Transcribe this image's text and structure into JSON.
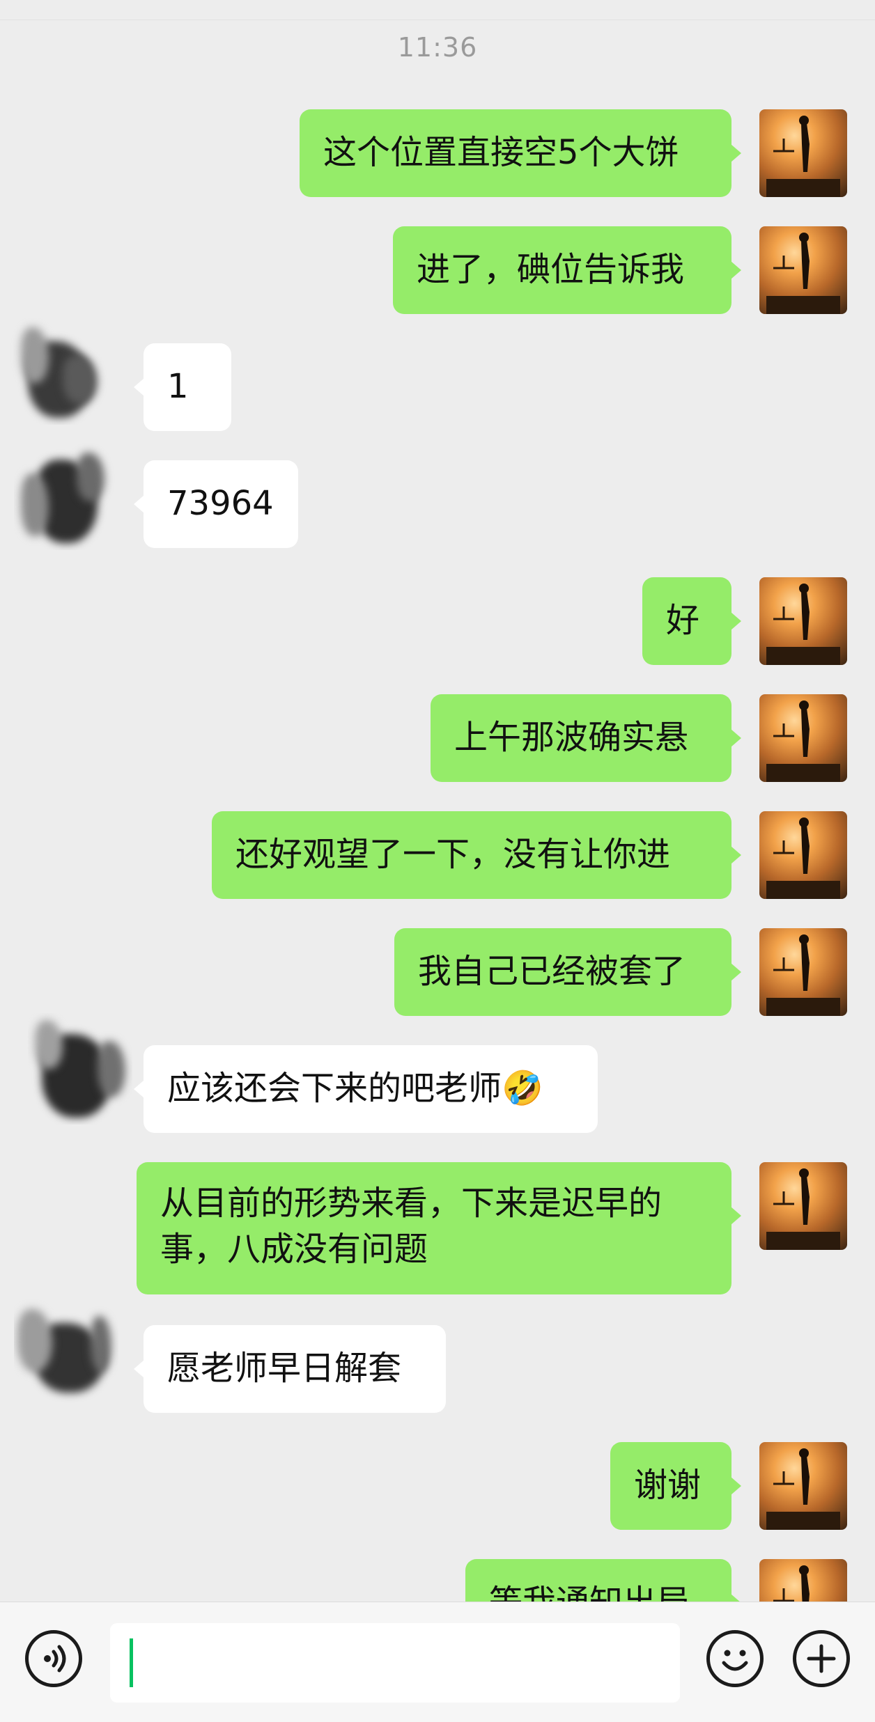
{
  "chat": {
    "timestamp": "11:36",
    "messages": [
      {
        "side": "sent",
        "text": "这个位置直接空5个大饼"
      },
      {
        "side": "sent",
        "text": "进了，碘位告诉我"
      },
      {
        "side": "recv",
        "text": "1"
      },
      {
        "side": "recv",
        "text": "73964"
      },
      {
        "side": "sent",
        "text": "好"
      },
      {
        "side": "sent",
        "text": "上午那波确实悬"
      },
      {
        "side": "sent",
        "text": "还好观望了一下，没有让你进"
      },
      {
        "side": "sent",
        "text": "我自己已经被套了"
      },
      {
        "side": "recv",
        "text": "应该还会下来的吧老师🤣"
      },
      {
        "side": "sent",
        "text": "从目前的形势来看，下来是迟早的事，八成没有问题"
      },
      {
        "side": "recv",
        "text": "愿老师早日解套"
      },
      {
        "side": "sent",
        "text": "谢谢"
      },
      {
        "side": "sent",
        "text": "等我通知出局"
      }
    ]
  },
  "input_bar": {
    "voice_icon": "voice-icon",
    "emoji_icon": "emoji-icon",
    "plus_icon": "plus-icon",
    "input_value": ""
  },
  "colors": {
    "background": "#ededed",
    "sent_bubble": "#95ec69",
    "recv_bubble": "#ffffff",
    "timestamp": "#9a9a9a",
    "caret": "#07c160"
  }
}
